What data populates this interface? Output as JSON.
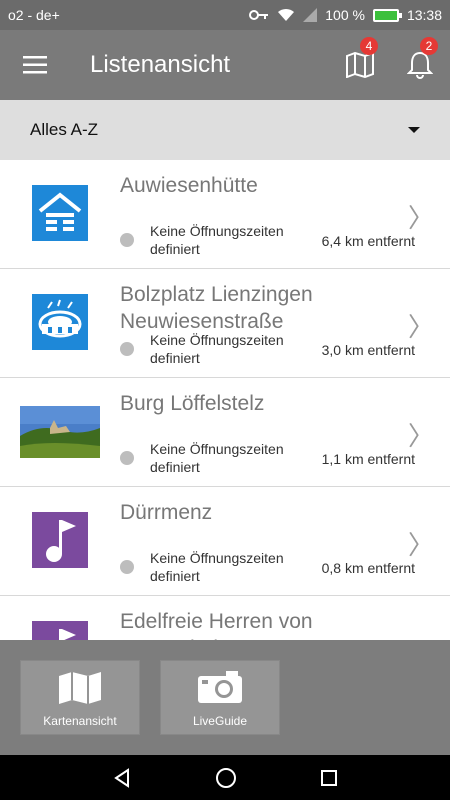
{
  "status_bar": {
    "carrier": "o2 - de+",
    "battery": "100 %",
    "time": "13:38"
  },
  "app_bar": {
    "title": "Listenansicht",
    "map_badge": "4",
    "notification_badge": "2"
  },
  "filter": {
    "selected": "Alles A-Z"
  },
  "items": [
    {
      "title": "Auwiesenhütte",
      "hours": "Keine Öffnungszeiten definiert",
      "distance": "6,4 km entfernt",
      "icon": "cabin-icon"
    },
    {
      "title": "Bolzplatz Lienzingen Neuwiesenstraße",
      "hours": "Keine Öffnungszeiten definiert",
      "distance": "3,0 km entfernt",
      "icon": "stadium-icon"
    },
    {
      "title": "Burg Löffelstelz",
      "hours": "Keine Öffnungszeiten definiert",
      "distance": "1,1 km entfernt",
      "icon": "castle-photo"
    },
    {
      "title": "Dürrmenz",
      "hours": "Keine Öffnungszeiten definiert",
      "distance": "0,8 km entfernt",
      "icon": "music-flag-icon"
    },
    {
      "title": "Edelfreie Herren von Lomersheim",
      "hours": "",
      "distance": "",
      "icon": "music-flag-icon"
    }
  ],
  "bottom_bar": {
    "map_label": "Kartenansicht",
    "liveguide_label": "LiveGuide"
  },
  "colors": {
    "app_bar": "#7a7a7a",
    "accent_blue": "#1e88d8",
    "accent_purple": "#7b4a9e",
    "badge_red": "#e53935"
  }
}
